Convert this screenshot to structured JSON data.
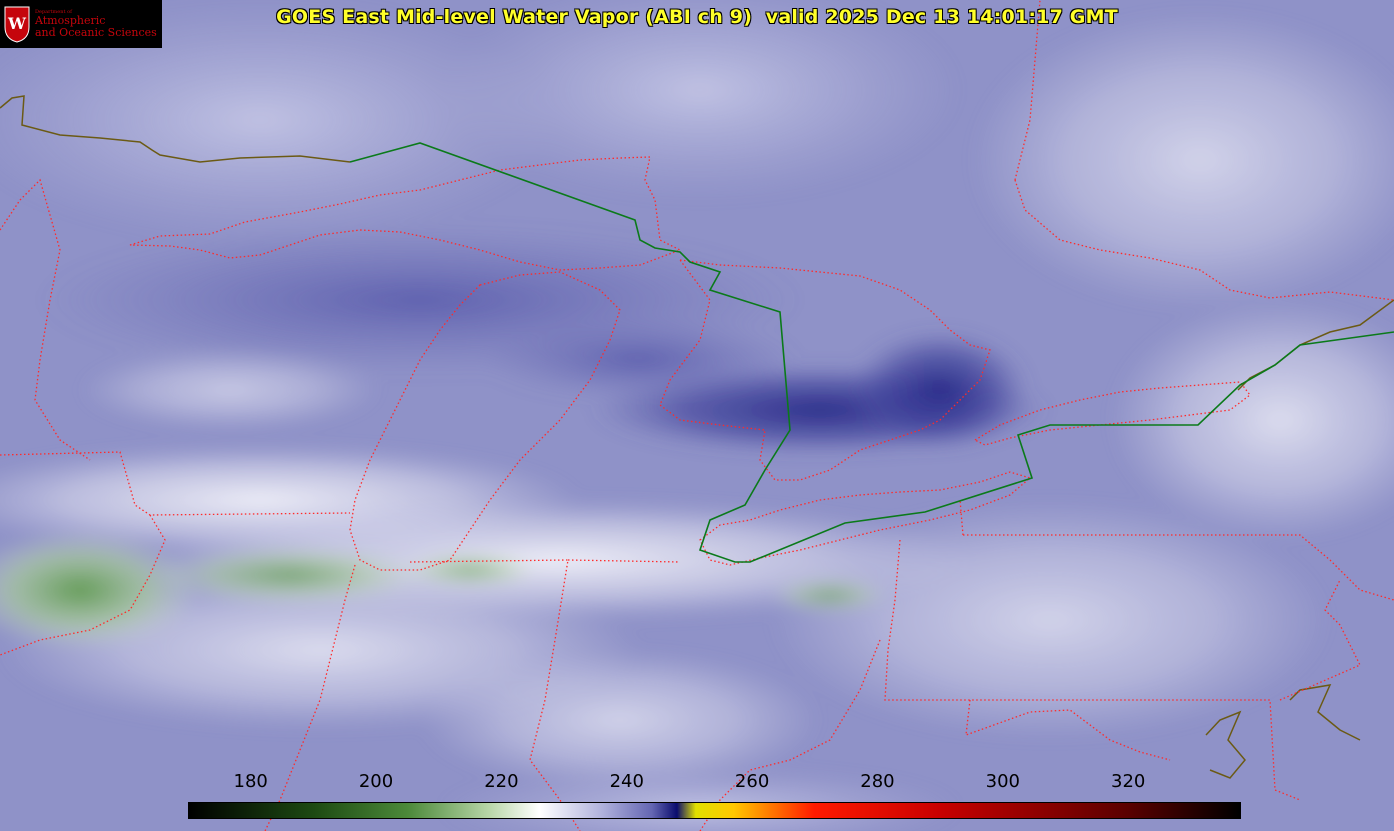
{
  "title": "GOES East Mid-level Water Vapor (ABI ch 9)  valid 2025 Dec 13 14:01:17 GMT",
  "logo": {
    "department": "Department of",
    "line1": "Atmospheric",
    "line2": "and Oceanic Sciences"
  },
  "colorbar": {
    "min": 170,
    "max": 338,
    "ticks": [
      "180",
      "200",
      "220",
      "240",
      "260",
      "280",
      "300",
      "320"
    ],
    "colors": [
      [
        170,
        "#000000"
      ],
      [
        190,
        "#1d4a12"
      ],
      [
        205,
        "#4c8a3a"
      ],
      [
        218,
        "#b8d6a8"
      ],
      [
        226,
        "#ffffff"
      ],
      [
        236,
        "#b0b2dc"
      ],
      [
        244,
        "#6466b2"
      ],
      [
        248,
        "#0a0c6e"
      ],
      [
        251,
        "#e0e000"
      ],
      [
        257,
        "#ffc800"
      ],
      [
        270,
        "#ff1a00"
      ],
      [
        290,
        "#c80000"
      ],
      [
        320,
        "#5a0000"
      ],
      [
        338,
        "#000000"
      ]
    ]
  },
  "colors": {
    "state_borders": "#ff2a2a",
    "international_border": "#0b7a1a",
    "coastline": "#6b5a14"
  }
}
